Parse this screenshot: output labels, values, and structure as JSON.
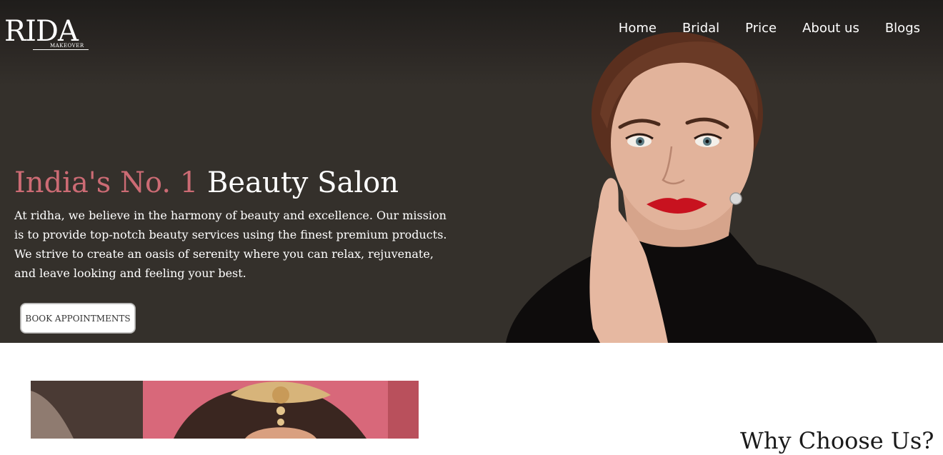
{
  "brand": {
    "name": "RIDA",
    "tagline": "MAKEOVER"
  },
  "nav": {
    "items": [
      {
        "label": "Home"
      },
      {
        "label": "Bridal"
      },
      {
        "label": "Price"
      },
      {
        "label": "About us"
      },
      {
        "label": "Blogs"
      }
    ]
  },
  "hero": {
    "headline_accent": "India's No. 1",
    "headline_main": "Beauty Salon",
    "paragraph": "At ridha, we believe in the harmony of beauty and excellence. Our mission is to provide top-notch beauty services using the finest premium products. We strive to create an oasis of serenity where you can relax, rejuvenate, and leave looking and feeling your best.",
    "cta_label": "BOOK APPOINTMENTS"
  },
  "section": {
    "heading": "Why Choose Us?"
  },
  "colors": {
    "hero_background": "#34302b",
    "accent": "#cc6b74",
    "text_light": "#ffffff"
  }
}
